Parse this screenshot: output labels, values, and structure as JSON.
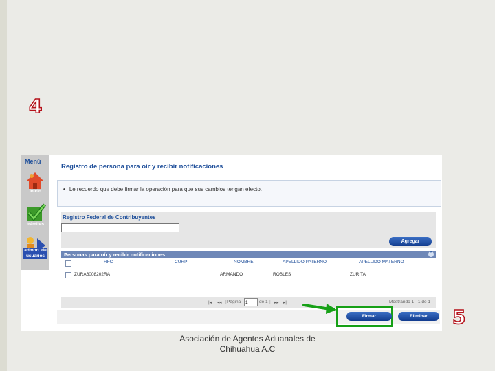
{
  "step_numbers": {
    "first": "4",
    "second": "5"
  },
  "menu": {
    "title": "Menú",
    "items": [
      {
        "label": "inicio",
        "icon": "home-icon"
      },
      {
        "label": "trámites",
        "icon": "checkmark-icon"
      },
      {
        "label": "admon. de usuarios",
        "icon": "users-icon"
      }
    ]
  },
  "main": {
    "title": "Registro de persona para oír y recibir notificaciones",
    "notice": "Le recuerdo que debe firmar la operación para que sus cambios tengan efecto."
  },
  "form": {
    "rfc_label": "Registro Federal de Contribuyentes",
    "rfc_value": "",
    "add_button": "Agregar"
  },
  "grid": {
    "title": "Personas para oír y recibir notificaciones",
    "columns": [
      "RFC",
      "CURP",
      "NOMBRE",
      "APELLIDO PATERNO",
      "APELLIDO MATERNO"
    ],
    "rows": [
      {
        "rfc": "ZURA6008202RA",
        "curp": "",
        "nombre": "ARMANDO",
        "apellido_paterno": "ROBLES",
        "apellido_materno": "ZURITA"
      }
    ]
  },
  "pager": {
    "page_label": "Página",
    "page_value": "1",
    "of_label": "de 1",
    "showing": "Mostrando 1 - 1 de 1"
  },
  "actions": {
    "sign_button": "Firmar",
    "delete_button": "Eliminar"
  },
  "footer": {
    "line1": "Asociación de Agentes Aduanales de",
    "line2": "Chihuahua A.C"
  },
  "colors": {
    "accent": "#1f4f9a",
    "highlight": "#16a016",
    "step_number": "#b5121b"
  }
}
